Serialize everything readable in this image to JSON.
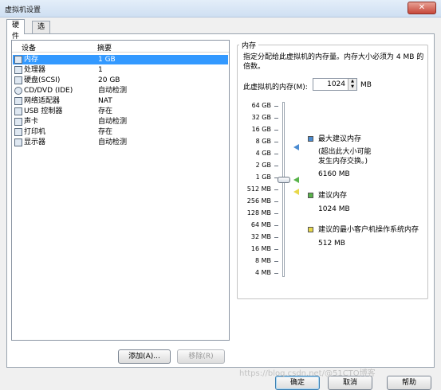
{
  "window": {
    "title": "虚拟机设置",
    "close_glyph": "✕"
  },
  "tabs": [
    {
      "label": "硬件",
      "active": true
    },
    {
      "label": "选项",
      "active": false
    }
  ],
  "device_list": {
    "headers": {
      "device": "设备",
      "summary": "摘要"
    },
    "rows": [
      {
        "name": "内存",
        "summary": "1 GB",
        "icon": "memory-icon",
        "selected": true
      },
      {
        "name": "处理器",
        "summary": "1",
        "icon": "processor-icon"
      },
      {
        "name": "硬盘(SCSI)",
        "summary": "20 GB",
        "icon": "hard-disk-icon"
      },
      {
        "name": "CD/DVD (IDE)",
        "summary": "自动检测",
        "icon": "cd-dvd-icon"
      },
      {
        "name": "网络适配器",
        "summary": "NAT",
        "icon": "network-adapter-icon"
      },
      {
        "name": "USB 控制器",
        "summary": "存在",
        "icon": "usb-icon"
      },
      {
        "name": "声卡",
        "summary": "自动检测",
        "icon": "sound-card-icon"
      },
      {
        "name": "打印机",
        "summary": "存在",
        "icon": "printer-icon"
      },
      {
        "name": "显示器",
        "summary": "自动检测",
        "icon": "display-icon"
      }
    ]
  },
  "buttons": {
    "add": "添加(A)...",
    "remove": "移除(R)",
    "ok": "确定",
    "cancel": "取消",
    "help": "帮助"
  },
  "memory": {
    "group_title": "内存",
    "hint": "指定分配给此虚拟机的内存量。内存大小必须为 4 MB 的倍数。",
    "field_label": "此虚拟机的内存(M):",
    "value": "1024",
    "unit": "MB",
    "scale": [
      "64 GB",
      "32 GB",
      "16 GB",
      "8 GB",
      "4 GB",
      "2 GB",
      "1 GB",
      "512 MB",
      "256 MB",
      "128 MB",
      "64 MB",
      "32 MB",
      "16 MB",
      "8 MB",
      "4 MB"
    ],
    "current_position": "1 GB",
    "legend": {
      "max": {
        "label": "最大建议内存",
        "note_line1": "(超出此大小可能",
        "note_line2": "发生内存交换。)",
        "value": "6160 MB",
        "color": "#4a8bd1"
      },
      "recommended": {
        "label": "建议内存",
        "value": "1024 MB",
        "color": "#58b34a"
      },
      "min": {
        "label": "建议的最小客户机操作系统内存",
        "value": "512 MB",
        "color": "#e8d84a"
      }
    }
  },
  "watermark": "https://blog.csdn.net/@51CTO博客"
}
